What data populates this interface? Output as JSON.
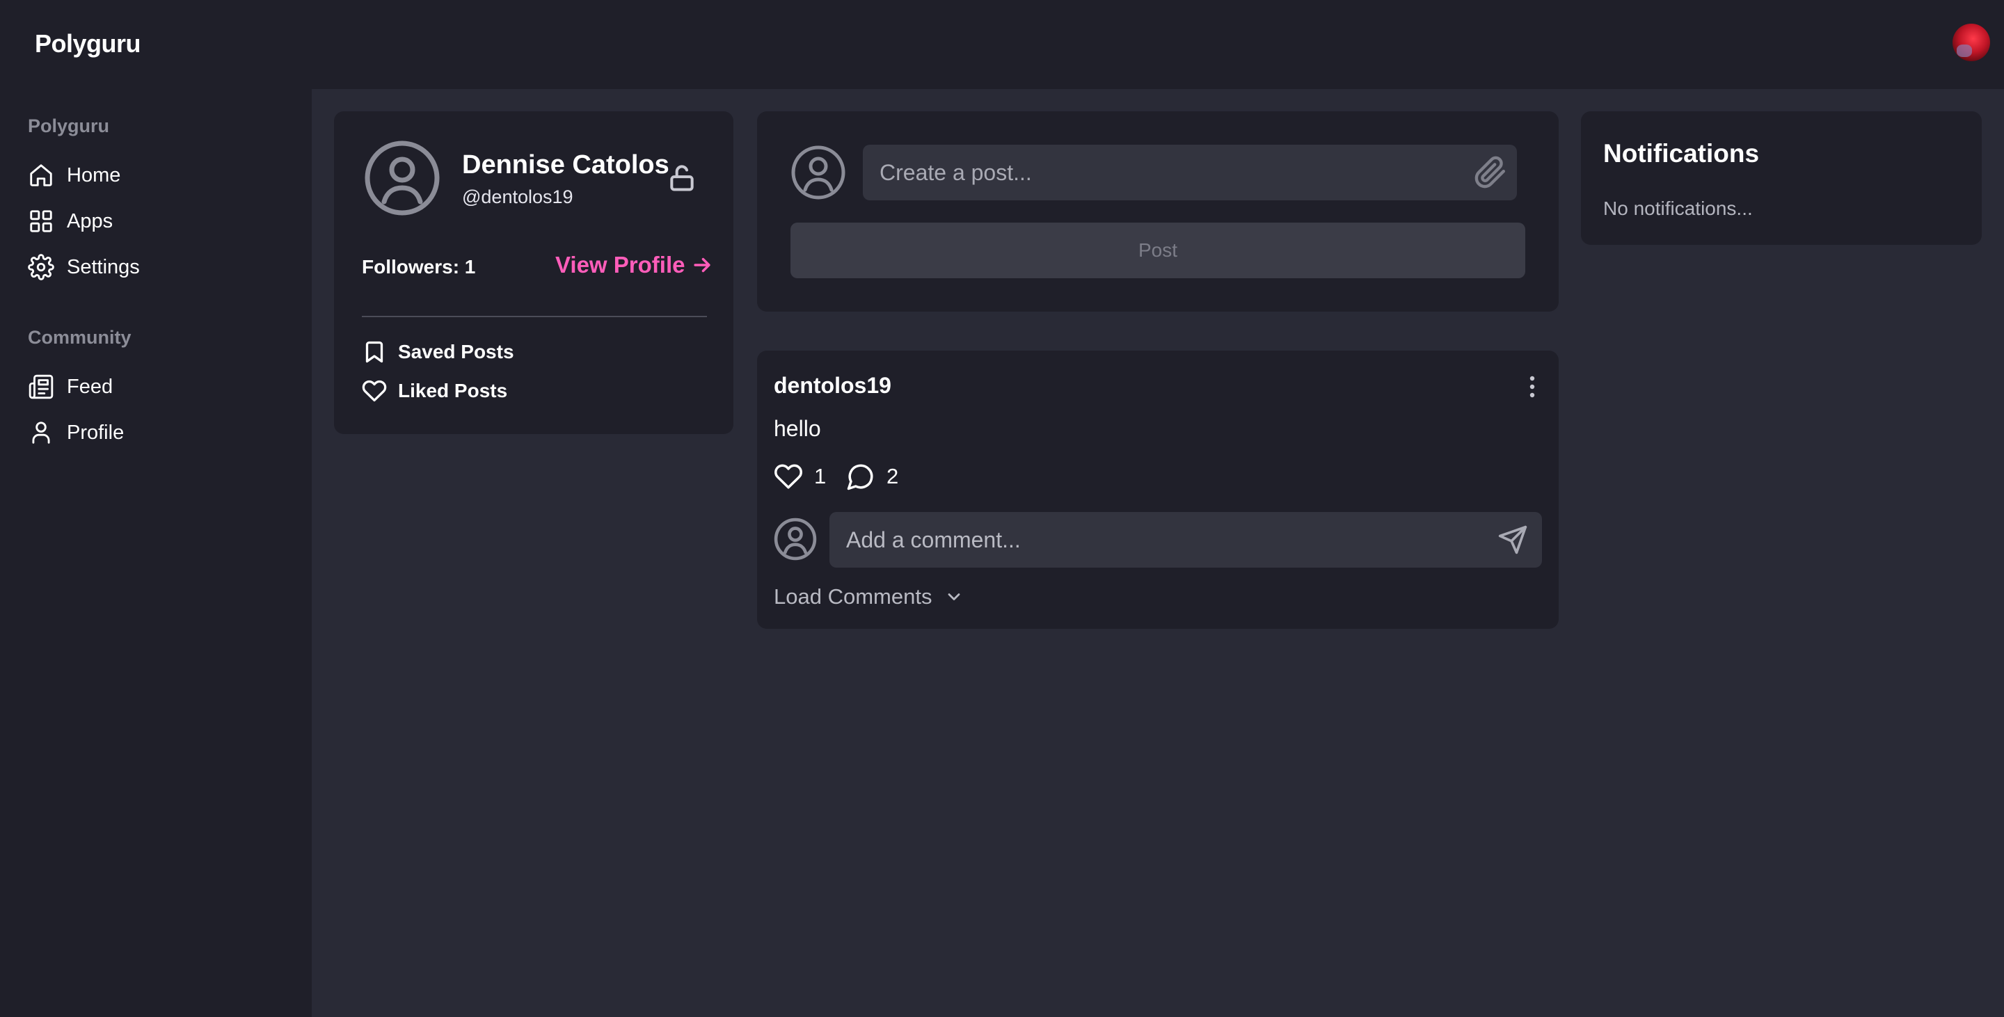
{
  "app": {
    "brand": "Polyguru"
  },
  "sidebar": {
    "sections": [
      {
        "heading": "Polyguru",
        "items": [
          {
            "label": "Home",
            "icon": "home-icon"
          },
          {
            "label": "Apps",
            "icon": "grid-icon"
          },
          {
            "label": "Settings",
            "icon": "gear-icon"
          }
        ]
      },
      {
        "heading": "Community",
        "items": [
          {
            "label": "Feed",
            "icon": "newspaper-icon"
          },
          {
            "label": "Profile",
            "icon": "user-icon"
          }
        ]
      }
    ]
  },
  "profile": {
    "name": "Dennise Catolos",
    "handle": "@dentolos19",
    "followers": "Followers: 1",
    "view_profile": "View Profile",
    "links": [
      {
        "label": "Saved Posts",
        "icon": "bookmark-icon"
      },
      {
        "label": "Liked Posts",
        "icon": "heart-icon"
      }
    ]
  },
  "create_post": {
    "placeholder": "Create a post...",
    "button_label": "Post"
  },
  "post": {
    "author": "dentolos19",
    "body": "hello",
    "likes": "1",
    "comments": "2",
    "comment_placeholder": "Add a comment...",
    "load_comments": "Load Comments"
  },
  "notifications": {
    "title": "Notifications",
    "empty": "No notifications..."
  },
  "colors": {
    "background": "#292a36",
    "panel": "#1f1f29",
    "input": "#33343f",
    "accent": "#ff5dba",
    "muted": "#8c8d98"
  }
}
